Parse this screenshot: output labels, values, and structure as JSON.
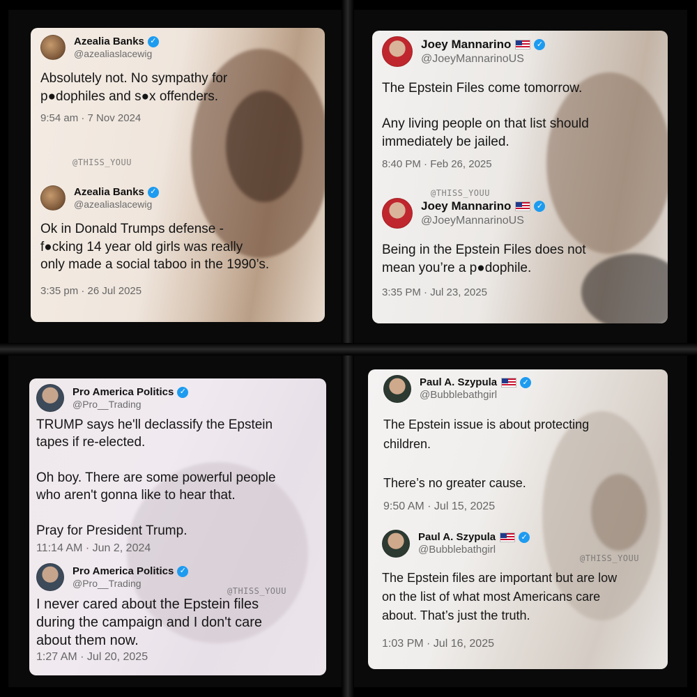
{
  "panels": [
    {
      "tweets": [
        {
          "name": "Azealia Banks",
          "handle": "@azealiaslacewig",
          "flag": false,
          "text": "Absolutely not. No sympathy for\np●dophiles and s●x offenders.",
          "time": "9:54 am · 7 Nov 2024"
        },
        {
          "name": "Azealia Banks",
          "handle": "@azealiaslacewig",
          "flag": false,
          "text": "Ok in Donald Trumps defense -\nf●cking 14 year old girls was really\nonly made a social taboo in the 1990’s.",
          "time": "3:35 pm · 26 Jul 2025"
        }
      ],
      "watermark": "@THISS_YOUU"
    },
    {
      "tweets": [
        {
          "name": "Joey Mannarino",
          "handle": "@JoeyMannarinoUS",
          "flag": true,
          "text": "The Epstein Files come tomorrow.\n\nAny living people on that list should\nimmediately be jailed.",
          "time": "8:40 PM · Feb 26, 2025"
        },
        {
          "name": "Joey Mannarino",
          "handle": "@JoeyMannarinoUS",
          "flag": true,
          "text": "Being in the Epstein Files does not\nmean you’re a p●dophile.",
          "time": "3:35 PM · Jul 23, 2025"
        }
      ],
      "watermark": "@THISS_YOUU"
    },
    {
      "tweets": [
        {
          "name": "Pro America Politics",
          "handle": "@Pro__Trading",
          "flag": false,
          "text": "TRUMP says he'll declassify the Epstein\ntapes if re-elected.\n\nOh boy. There are some powerful  people\nwho aren't gonna like to hear that.\n\nPray for President Trump.",
          "time": "11:14 AM · Jun 2, 2024"
        },
        {
          "name": "Pro America Politics",
          "handle": "@Pro__Trading",
          "flag": false,
          "text": "I never cared about the Epstein files\nduring the campaign and I don't care\nabout them now.",
          "time": "1:27 AM · Jul 20, 2025"
        }
      ],
      "watermark": "@THISS_YOUU"
    },
    {
      "tweets": [
        {
          "name": "Paul A. Szypula",
          "handle": "@Bubblebathgirl",
          "flag": true,
          "text": "The Epstein issue is about protecting\nchildren.\n\nThere’s no greater cause.",
          "time": "9:50 AM · Jul 15, 2025"
        },
        {
          "name": "Paul A. Szypula",
          "handle": "@Bubblebathgirl",
          "flag": true,
          "text": "The Epstein files are important but are low\non the list of what most Americans care\nabout. That’s just the truth.",
          "time": "1:03 PM · Jul 16, 2025"
        }
      ],
      "watermark": "@THISS_YOUU"
    }
  ],
  "verified_glyph": "✓"
}
